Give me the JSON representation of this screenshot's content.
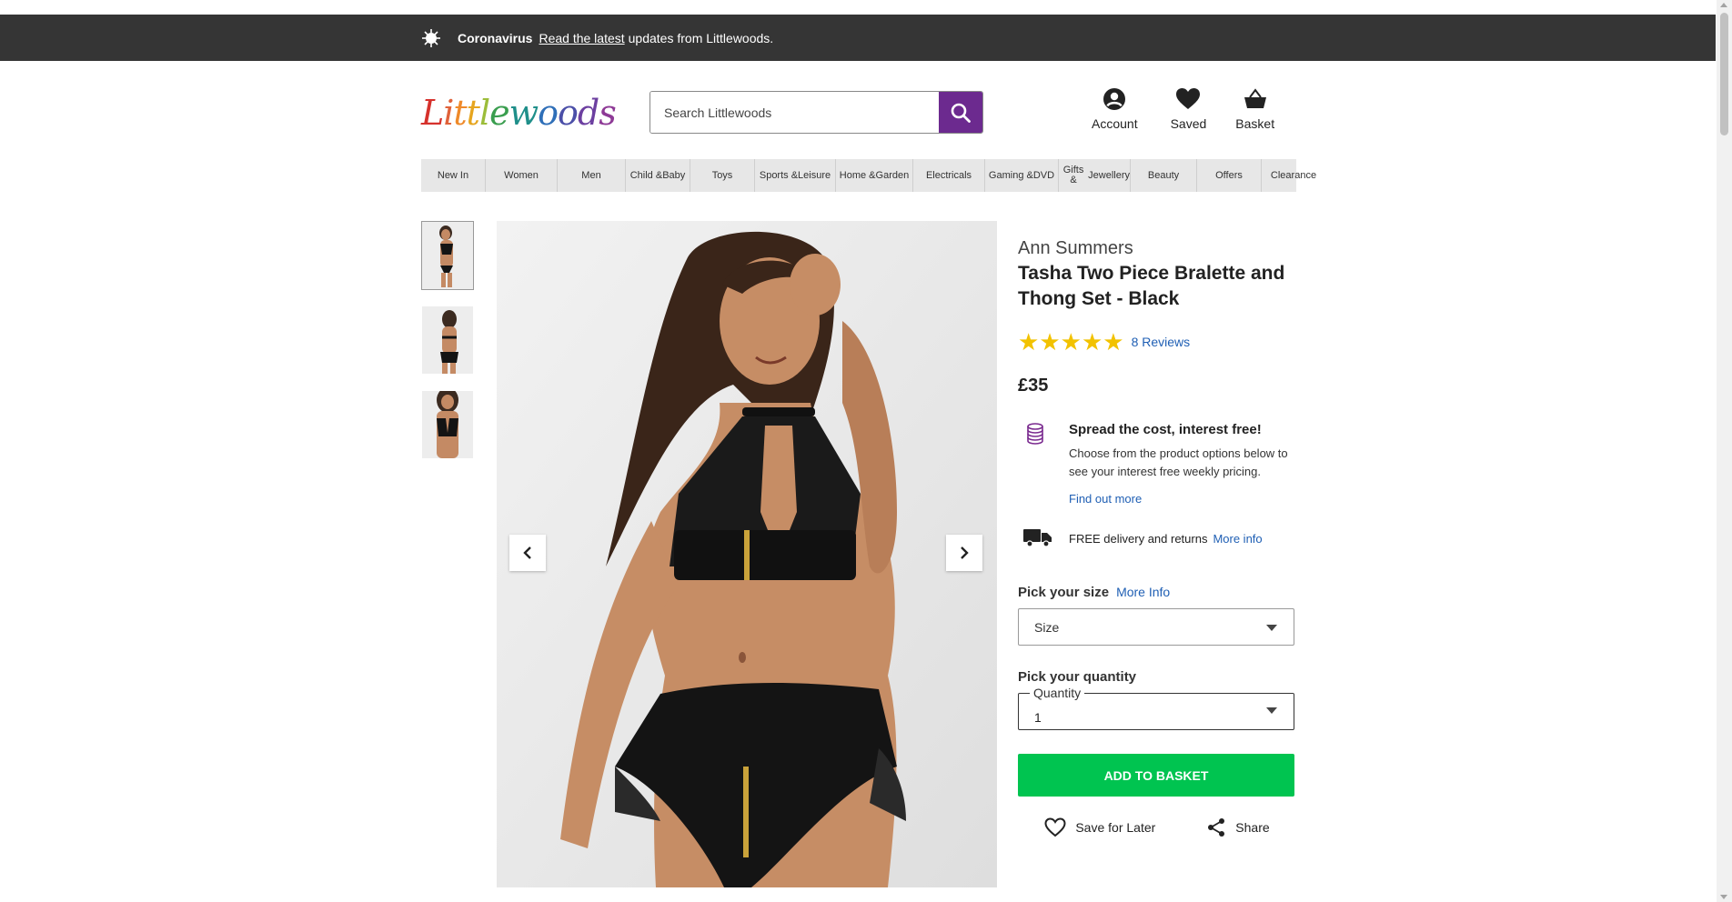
{
  "banner": {
    "icon": "coronavirus-icon",
    "bold": "Coronavirus",
    "link": "Read the latest",
    "text": "updates from Littlewoods."
  },
  "logo": {
    "text": "Littlewoods"
  },
  "search": {
    "placeholder": "Search Littlewoods"
  },
  "header": {
    "account": "Account",
    "saved": "Saved",
    "basket": "Basket"
  },
  "nav": [
    {
      "line1": "New In",
      "line2": ""
    },
    {
      "line1": "Women",
      "line2": ""
    },
    {
      "line1": "Men",
      "line2": ""
    },
    {
      "line1": "Child &",
      "line2": "Baby"
    },
    {
      "line1": "Toys",
      "line2": ""
    },
    {
      "line1": "Sports &",
      "line2": "Leisure"
    },
    {
      "line1": "Home &",
      "line2": "Garden"
    },
    {
      "line1": "Electricals",
      "line2": ""
    },
    {
      "line1": "Gaming &",
      "line2": "DVD"
    },
    {
      "line1": "Gifts &",
      "line2": "Jewellery"
    },
    {
      "line1": "Beauty",
      "line2": ""
    },
    {
      "line1": "Offers",
      "line2": ""
    },
    {
      "line1": "Clearance",
      "line2": ""
    }
  ],
  "product": {
    "brand": "Ann Summers",
    "title": "Tasha Two Piece Bralette and Thong Set - Black",
    "rating": 5,
    "reviews": "8 Reviews",
    "price": "£35",
    "finance_title": "Spread the cost, interest free!",
    "finance_text": "Choose from the product options below to see your interest free weekly pricing.",
    "finance_link": "Find out more",
    "delivery_text": "FREE delivery and returns",
    "delivery_link": "More info",
    "size_label": "Pick your size",
    "size_link": "More Info",
    "size_value": "Size",
    "qty_label": "Pick your quantity",
    "qty_float": "Quantity",
    "qty_value": "1",
    "add_button": "ADD TO BASKET",
    "save_later": "Save for Later",
    "share": "Share"
  },
  "colors": {
    "banner_bg": "#353535",
    "brand_purple": "#6c2a8f",
    "link_blue": "#1f5fb4",
    "add_green": "#00c450",
    "star_gold": "#f2c200"
  }
}
